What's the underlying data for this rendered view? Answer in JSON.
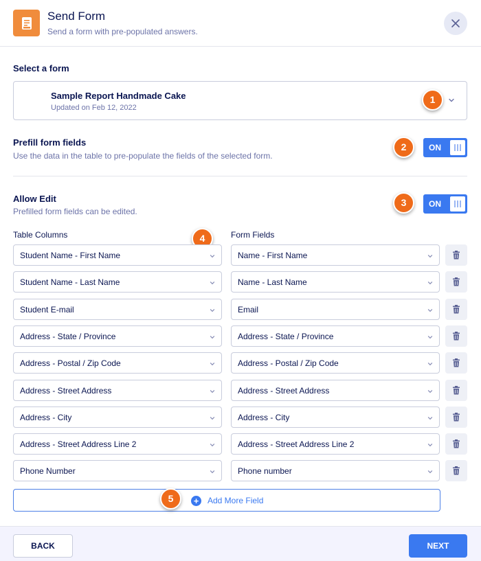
{
  "header": {
    "title": "Send Form",
    "subtitle": "Send a form with pre-populated answers.",
    "icon": "form-document-icon",
    "accent_color": "#f08c3c"
  },
  "select_form": {
    "label": "Select a form",
    "form_title": "Sample Report Handmade Cake",
    "form_updated": "Updated on Feb 12, 2022"
  },
  "prefill": {
    "label": "Prefill form fields",
    "description": "Use the data in the table to pre-populate the fields of the selected form.",
    "toggle_text": "ON",
    "enabled": true
  },
  "allow_edit": {
    "label": "Allow Edit",
    "description": "Prefilled form fields can be edited.",
    "toggle_text": "ON",
    "enabled": true
  },
  "mapping": {
    "left_header": "Table Columns",
    "right_header": "Form Fields",
    "rows": [
      {
        "column": "Student Name - First Name",
        "field": "Name - First Name"
      },
      {
        "column": "Student Name - Last Name",
        "field": "Name - Last Name"
      },
      {
        "column": "Student E-mail",
        "field": "Email"
      },
      {
        "column": "Address - State / Province",
        "field": "Address - State / Province"
      },
      {
        "column": "Address - Postal / Zip Code",
        "field": "Address - Postal / Zip Code"
      },
      {
        "column": "Address - Street Address",
        "field": "Address - Street Address"
      },
      {
        "column": "Address - City",
        "field": "Address - City"
      },
      {
        "column": "Address - Street Address Line 2",
        "field": "Address - Street Address Line 2"
      },
      {
        "column": "Phone Number",
        "field": "Phone number"
      }
    ],
    "add_label": "Add More Field"
  },
  "footer": {
    "back_label": "BACK",
    "next_label": "NEXT"
  },
  "callouts": [
    "1",
    "2",
    "3",
    "4",
    "5"
  ],
  "colors": {
    "primary": "#3a79f0",
    "callout": "#ef6b1a",
    "text": "#0a1551"
  }
}
